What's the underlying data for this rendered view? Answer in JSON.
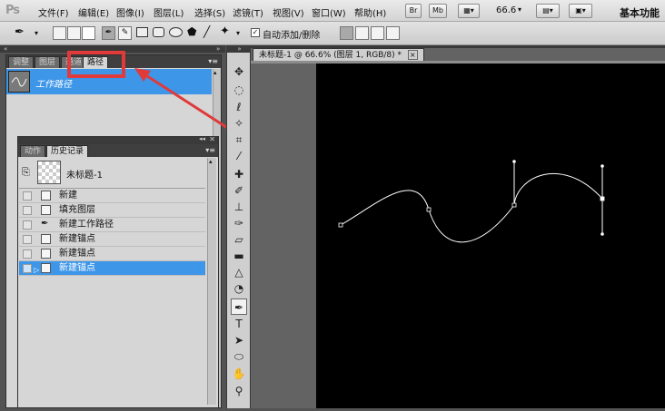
{
  "app": {
    "logo": "Ps"
  },
  "menu": [
    "文件(F)",
    "编辑(E)",
    "图像(I)",
    "图层(L)",
    "选择(S)",
    "滤镜(T)",
    "视图(V)",
    "窗口(W)",
    "帮助(H)"
  ],
  "menubar_buttons": {
    "bridge": "Br",
    "mini_bridge": "Mb",
    "zoom": "66.6"
  },
  "workspace_label": "基本功能",
  "options": {
    "auto_add_delete": "自动添加/删除",
    "auto_add_delete_checked": true
  },
  "paths_panel": {
    "tabs": [
      "调整",
      "图层",
      "通道",
      "路径"
    ],
    "active_tab": "路径",
    "items": [
      {
        "label": "工作路径",
        "selected": true
      }
    ]
  },
  "history_panel": {
    "tabs": [
      "动作",
      "历史记录"
    ],
    "active_tab": "历史记录",
    "snapshot": "未标题-1",
    "rows": [
      "新建",
      "填充图层",
      "新建工作路径",
      "新建锚点",
      "新建锚点",
      "新建锚点"
    ],
    "selected_index": 5
  },
  "document": {
    "tab_title": "未标题-1 @ 66.6% (图层 1, RGB/8) *",
    "close": "×"
  },
  "colors": {
    "highlight": "#e03a3a",
    "selection": "#3d96e8",
    "canvas": "#000000"
  }
}
